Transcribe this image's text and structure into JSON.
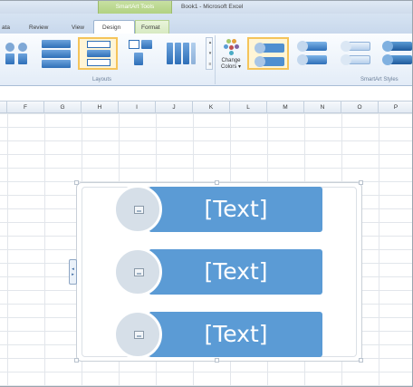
{
  "window": {
    "contextual_group": "SmartArt Tools",
    "title": "Book1 - Microsoft Excel"
  },
  "tabs": [
    {
      "label": "ata"
    },
    {
      "label": "Review"
    },
    {
      "label": "View"
    },
    {
      "label": "Design",
      "active": true
    },
    {
      "label": "Format"
    }
  ],
  "ribbon": {
    "layouts_label": "Layouts",
    "change_colors": {
      "line1": "Change",
      "line2": "Colors ▾"
    },
    "styles_label": "SmartArt Styles",
    "scroll_up": "▴",
    "scroll_down": "▾",
    "scroll_more": "≡"
  },
  "columns": [
    "F",
    "G",
    "H",
    "I",
    "J",
    "K",
    "L",
    "M",
    "N",
    "O",
    "P"
  ],
  "smartart": {
    "items": [
      {
        "text": "[Text]"
      },
      {
        "text": "[Text]"
      },
      {
        "text": "[Text]"
      }
    ],
    "handle_glyph_top": "◂",
    "handle_glyph_bottom": "▸"
  },
  "colors": {
    "accent": "#5b9bd5",
    "placeholder_circle": "#d6dfe8",
    "selection": "#f5c45a"
  }
}
